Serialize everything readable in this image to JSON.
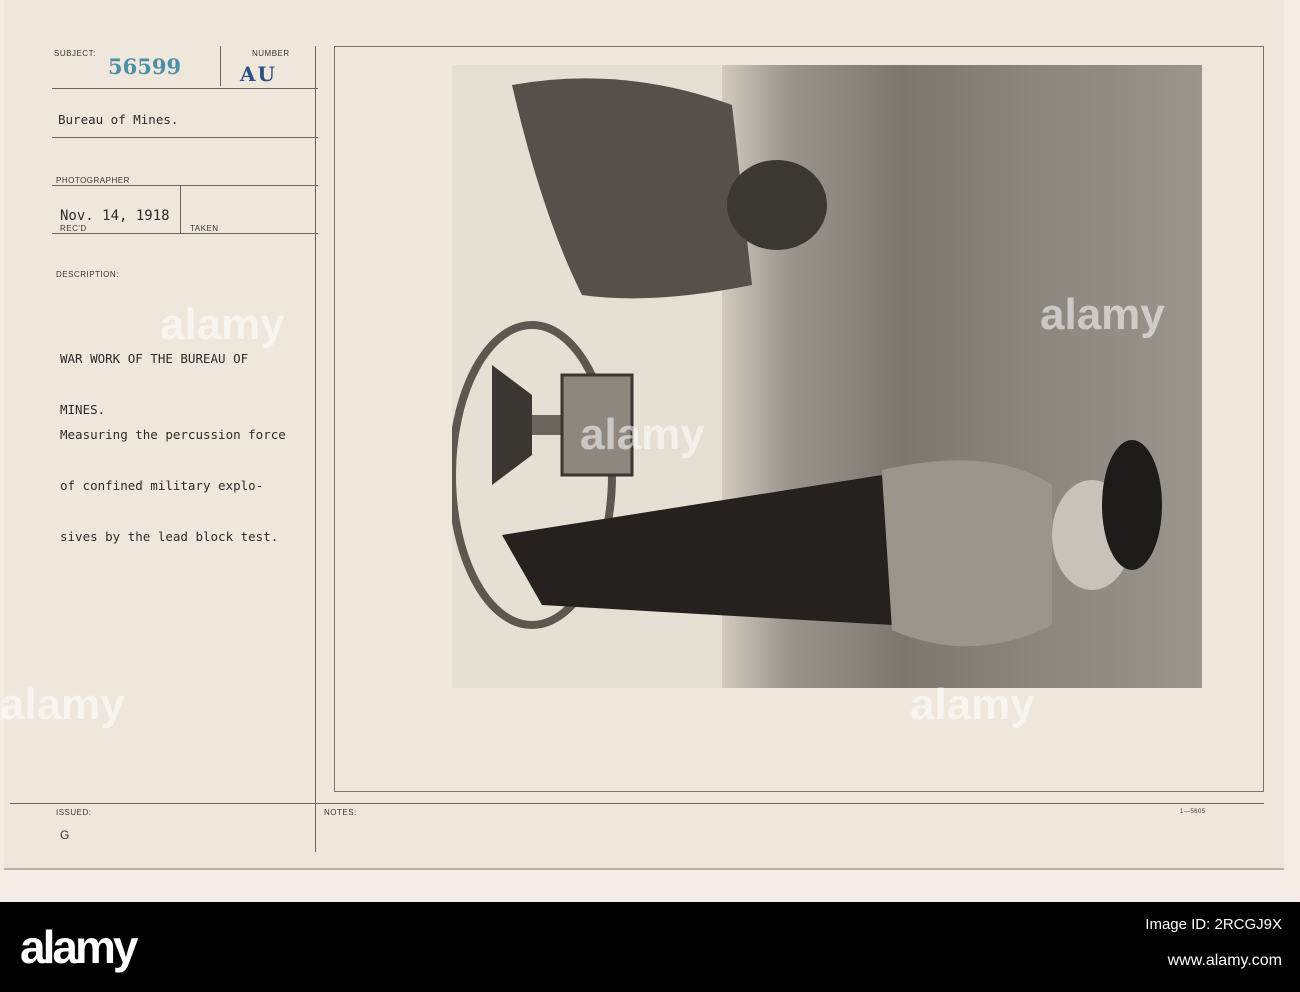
{
  "card": {
    "subject_label": "SUBJECT:",
    "subject_number": "56599",
    "number_label": "NUMBER",
    "number_value": "AU",
    "agency": "Bureau of Mines.",
    "photographer_label": "PHOTOGRAPHER",
    "date": "Nov. 14, 1918",
    "recd_label": "REC'D",
    "taken_label": "TAKEN",
    "description_label": "DESCRIPTION:",
    "description_title": [
      "WAR WORK OF THE BUREAU OF",
      "MINES."
    ],
    "description_body": [
      "Measuring the percussion force",
      "of confined military explo-",
      "sives by the lead block test."
    ],
    "issued_label": "ISSUED:",
    "issued_value": "G",
    "notes_label": "NOTES:",
    "form_number": "1—5605"
  },
  "watermark": "alamy",
  "footer": {
    "logo": "alamy",
    "image_id": "Image ID: 2RCGJ9X",
    "url": "www.alamy.com"
  },
  "colors": {
    "stamp_blue": "#4b8fa8",
    "number_blue": "#2b4f86"
  }
}
